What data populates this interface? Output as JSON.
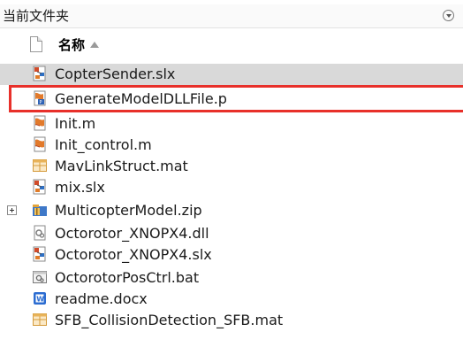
{
  "panel": {
    "title": "当前文件夹"
  },
  "columns": {
    "name_label": "名称"
  },
  "files": [
    {
      "name": "CopterSender.slx",
      "icon": "simulink-model-icon",
      "selected": true
    },
    {
      "name": "GenerateModelDLLFile.p",
      "icon": "p-code-file-icon",
      "highlighted": true
    },
    {
      "name": "Init.m",
      "icon": "matlab-script-icon"
    },
    {
      "name": "Init_control.m",
      "icon": "matlab-script-icon"
    },
    {
      "name": "MavLinkStruct.mat",
      "icon": "mat-file-icon"
    },
    {
      "name": "mix.slx",
      "icon": "simulink-model-icon"
    },
    {
      "name": "MulticopterModel.zip",
      "icon": "zip-archive-icon",
      "expandable": true
    },
    {
      "name": "Octorotor_XNOPX4.dll",
      "icon": "dll-file-icon"
    },
    {
      "name": "Octorotor_XNOPX4.slx",
      "icon": "simulink-model-icon"
    },
    {
      "name": "OctorotorPosCtrl.bat",
      "icon": "batch-file-icon"
    },
    {
      "name": "readme.docx",
      "icon": "word-document-icon"
    },
    {
      "name": "SFB_CollisionDetection_SFB.mat",
      "icon": "mat-file-icon"
    }
  ],
  "colors": {
    "selection": "#d9d9d9",
    "highlight_border": "#e8302a"
  }
}
